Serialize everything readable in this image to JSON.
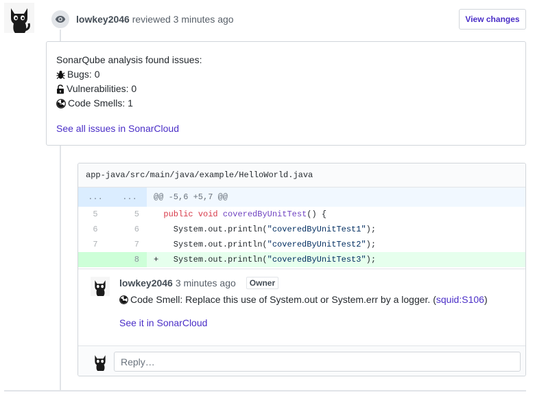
{
  "review": {
    "author": "lowkey2046",
    "action_text": " reviewed 3 minutes ago",
    "view_changes_label": "View changes",
    "summary_title": "SonarQube analysis found issues:",
    "issues": [
      {
        "icon": "bug-icon",
        "text": "Bugs: 0"
      },
      {
        "icon": "unlock-icon",
        "text": "Vulnerabilities: 0"
      },
      {
        "icon": "radiation-icon",
        "text": "Code Smells: 1"
      }
    ],
    "link_label": "See all issues in SonarCloud"
  },
  "diff": {
    "file_path": "app-java/src/main/java/example/HelloWorld.java",
    "hunk": {
      "old": "...",
      "new": "...",
      "header": "@@ -5,6 +5,7 @@"
    },
    "lines": [
      {
        "old": "5",
        "new": "5",
        "marker": " ",
        "code": "public void coveredByUnitTest() {"
      },
      {
        "old": "6",
        "new": "6",
        "marker": " ",
        "code": "  System.out.println(\"coveredByUnitTest1\");"
      },
      {
        "old": "7",
        "new": "7",
        "marker": " ",
        "code": "  System.out.println(\"coveredByUnitTest2\");"
      },
      {
        "old": "",
        "new": "8",
        "marker": "+",
        "code": "  System.out.println(\"coveredByUnitTest3\");"
      }
    ]
  },
  "comment": {
    "author": "lowkey2046",
    "time": "3 minutes ago",
    "badge": "Owner",
    "body_text": "Code Smell: Replace this use of System.out or System.err by a logger. (",
    "rule_link": "squid:S106",
    "body_close": ")",
    "link_label": "See it in SonarCloud"
  },
  "reply": {
    "placeholder": "Reply…"
  },
  "colors": {
    "link": "#4a2ec7",
    "added_bg": "#e6ffed",
    "hunk_bg": "#f1f8ff"
  }
}
